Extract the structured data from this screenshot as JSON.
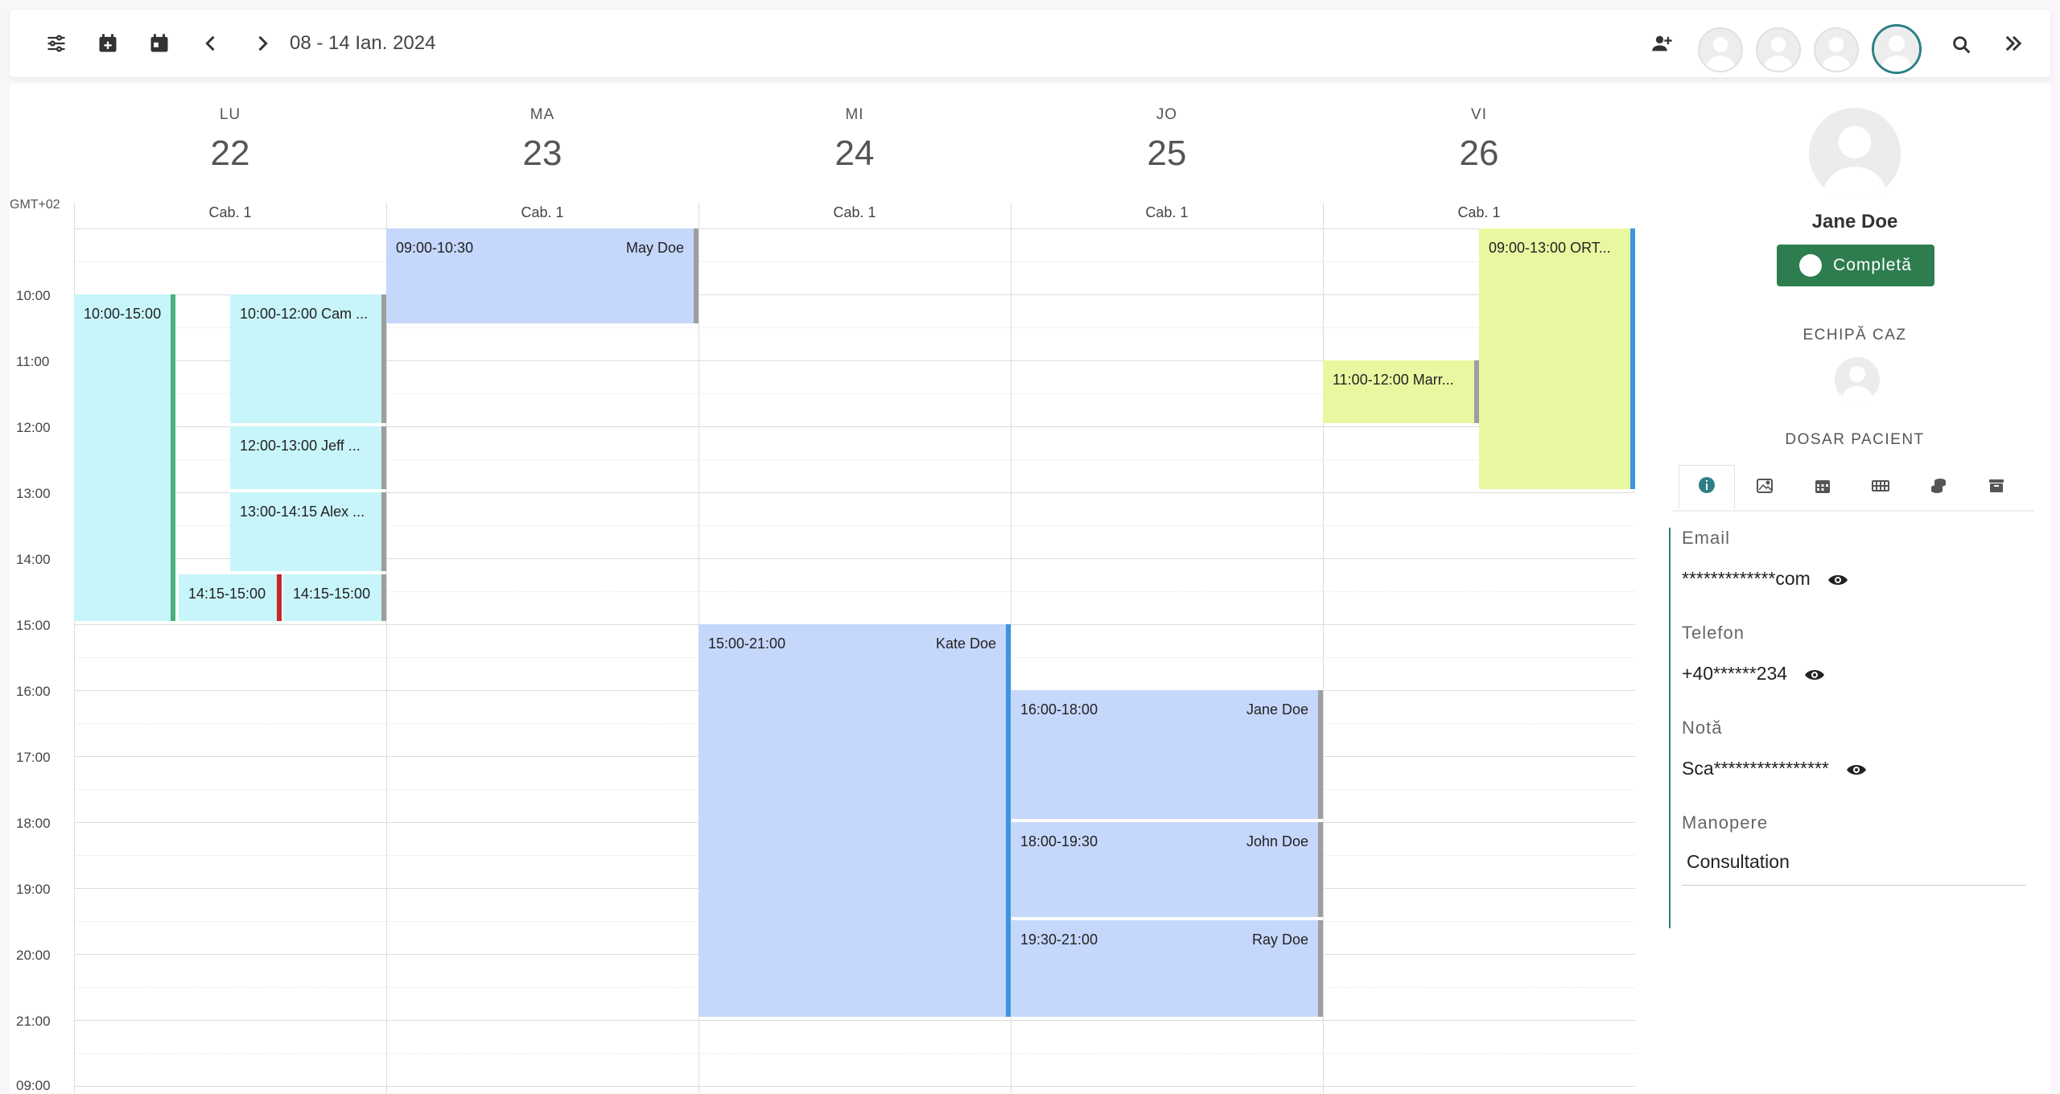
{
  "toolbar": {
    "date_range": "08 - 14 Ian. 2024"
  },
  "calendar": {
    "timezone": "GMT+02",
    "days": [
      {
        "abbr": "LU",
        "num": "22",
        "room": "Cab. 1"
      },
      {
        "abbr": "MA",
        "num": "23",
        "room": "Cab. 1"
      },
      {
        "abbr": "MI",
        "num": "24",
        "room": "Cab. 1"
      },
      {
        "abbr": "JO",
        "num": "25",
        "room": "Cab. 1"
      },
      {
        "abbr": "VI",
        "num": "26",
        "room": "Cab. 1"
      }
    ],
    "times": [
      "10:00",
      "11:00",
      "12:00",
      "13:00",
      "14:00",
      "15:00",
      "16:00",
      "17:00",
      "18:00",
      "19:00",
      "20:00",
      "21:00",
      "09:00"
    ],
    "events": [
      {
        "time": "10:00-15:00",
        "name": ""
      },
      {
        "time": "10:00-12:00 Cam ...",
        "name": ""
      },
      {
        "time": "12:00-13:00 Jeff ...",
        "name": ""
      },
      {
        "time": "13:00-14:15 Alex ...",
        "name": ""
      },
      {
        "time": "14:15-15:00",
        "name": ""
      },
      {
        "time": "14:15-15:00",
        "name": ""
      },
      {
        "time": "09:00-10:30",
        "name": "May Doe"
      },
      {
        "time": "15:00-21:00",
        "name": "Kate Doe"
      },
      {
        "time": "16:00-18:00",
        "name": "Jane Doe"
      },
      {
        "time": "18:00-19:30",
        "name": "John Doe"
      },
      {
        "time": "19:30-21:00",
        "name": "Ray Doe"
      },
      {
        "time": "11:00-12:00 Marr...",
        "name": ""
      },
      {
        "time": "09:00-13:00 ORT...",
        "name": ""
      }
    ],
    "colors": {
      "cyan": "#c8f5fa",
      "blue": "#c5d7fb",
      "lime": "#e9f8a0",
      "green_bar": "#4caf7d",
      "red_bar": "#c62828",
      "blue_bar": "#3d95e0",
      "gray_bar": "#9e9e9e"
    }
  },
  "panel": {
    "patient_name": "Jane Doe",
    "status_label": "Completă",
    "team_title": "ECHIPĂ CAZ",
    "file_title": "DOSAR PACIENT",
    "fields": [
      {
        "label": "Email",
        "value": "*************com"
      },
      {
        "label": "Telefon",
        "value": "+40******234"
      },
      {
        "label": "Notă",
        "value": "Sca****************"
      },
      {
        "label": "Manopere",
        "value": "Consultation"
      }
    ],
    "accent": "#2d7f86",
    "status_color": "#2e7d4f"
  }
}
